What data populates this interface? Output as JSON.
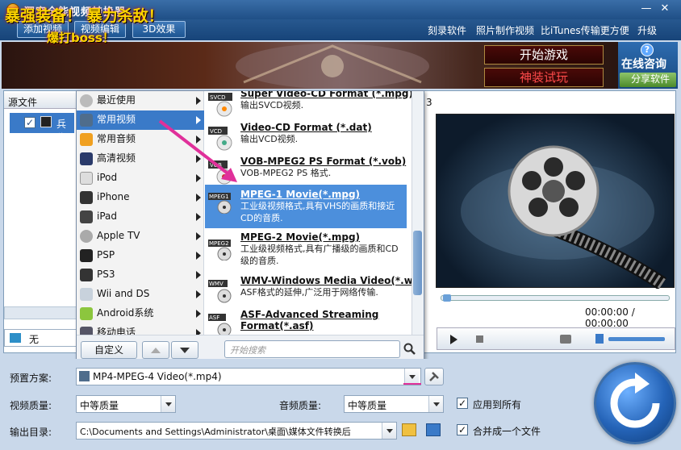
{
  "app": {
    "title": "狸窝全能视频转换器"
  },
  "toolbar": {
    "buttons": [
      "添加视频",
      "视频编辑",
      "3D效果"
    ],
    "links": [
      "刻录软件",
      "照片制作视频",
      "比iTunes传输更方便",
      "升级"
    ]
  },
  "banner": {
    "slogan1": "暴强装备！",
    "slogan2": "暴力杀敌！",
    "slogan3": "爆打boss！",
    "play_game": "开始游戏",
    "trial": "神装试玩",
    "consult": "在线咨询",
    "share": "分享软件",
    "consult_badge": "?"
  },
  "filelist": {
    "header": "源文件",
    "row_text": "兵临",
    "subtitle_value": "无",
    "col_num": "3"
  },
  "preview": {
    "time": "00:00:00 / 00:00:00"
  },
  "menu": {
    "categories": [
      {
        "label": "最近使用",
        "icon": "clock-icon"
      },
      {
        "label": "常用视频",
        "icon": "film-icon"
      },
      {
        "label": "常用音频",
        "icon": "music-icon"
      },
      {
        "label": "高清视频",
        "icon": "hd-icon"
      },
      {
        "label": "iPod",
        "icon": "ipod-icon"
      },
      {
        "label": "iPhone",
        "icon": "iphone-icon"
      },
      {
        "label": "iPad",
        "icon": "ipad-icon"
      },
      {
        "label": "Apple TV",
        "icon": "apple-icon"
      },
      {
        "label": "PSP",
        "icon": "psp-icon"
      },
      {
        "label": "PS3",
        "icon": "ps3-icon"
      },
      {
        "label": "Wii and DS",
        "icon": "wii-icon"
      },
      {
        "label": "Android系统",
        "icon": "android-icon"
      },
      {
        "label": "移动电话",
        "icon": "phone-icon"
      }
    ],
    "selected_category": 1,
    "formats": [
      {
        "badge": "SVCD",
        "name": "Super Video-CD Format (*.mpg)",
        "desc": "输出SVCD视频."
      },
      {
        "badge": "VCD",
        "name": "Video-CD Format (*.dat)",
        "desc": "输出VCD视频."
      },
      {
        "badge": "VOB",
        "name": "VOB-MPEG2 PS Format (*.vob)",
        "desc": "VOB-MPEG2 PS 格式."
      },
      {
        "badge": "MPEG1",
        "name": "MPEG-1 Movie(*.mpg)",
        "desc": "工业级视频格式,具有VHS的画质和接近CD的音质."
      },
      {
        "badge": "MPEG2",
        "name": "MPEG-2 Movie(*.mpg)",
        "desc": "工业级视频格式,具有广播级的画质和CD级的音质."
      },
      {
        "badge": "WMV",
        "name": "WMV-Windows Media Video(*.wmv)",
        "desc": "ASF格式的延伸,广泛用于网络传输."
      },
      {
        "badge": "ASF",
        "name": "ASF-Advanced Streaming Format(*.asf)",
        "desc": ""
      }
    ],
    "selected_format": 3,
    "custom_button": "自定义",
    "search_placeholder": "开始搜索"
  },
  "settings": {
    "preset_label": "预置方案:",
    "preset_value": "MP4-MPEG-4 Video(*.mp4)",
    "video_quality_label": "视频质量:",
    "video_quality_value": "中等质量",
    "audio_quality_label": "音频质量:",
    "audio_quality_value": "中等质量",
    "apply_all": "应用到所有",
    "output_label": "输出目录:",
    "output_value": "C:\\Documents and Settings\\Administrator\\桌面\\媒体文件转换后",
    "merge": "合并成一个文件"
  },
  "colors": {
    "accent": "#3a7ac8",
    "highlight": "#4c8fdc",
    "arrow": "#e0309a"
  }
}
